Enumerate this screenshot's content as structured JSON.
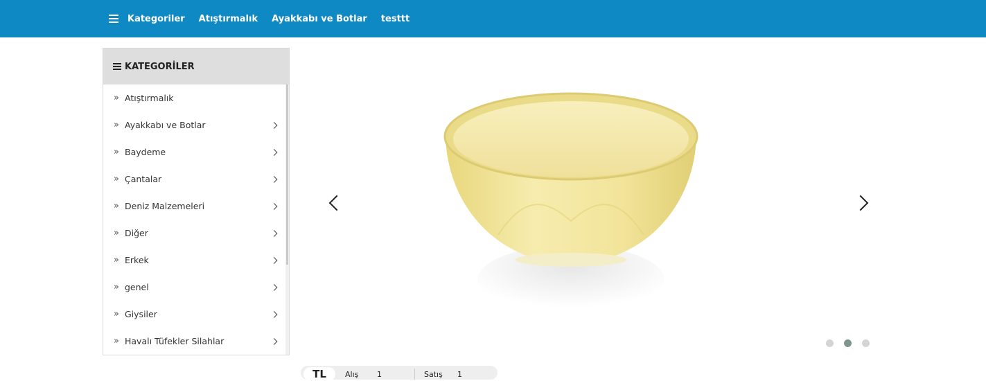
{
  "topnav": {
    "menu_icon": "hamburger-icon",
    "links": [
      "Kategoriler",
      "Atıştırmalık",
      "Ayakkabı ve Botlar",
      "testtt"
    ]
  },
  "categories": {
    "title": "KATEGORİLER",
    "items": [
      {
        "label": "Atıştırmalık",
        "has_sub": false
      },
      {
        "label": "Ayakkabı ve Botlar",
        "has_sub": true
      },
      {
        "label": "Baydeme",
        "has_sub": true
      },
      {
        "label": "Çantalar",
        "has_sub": true
      },
      {
        "label": "Deniz Malzemeleri",
        "has_sub": true
      },
      {
        "label": "Diğer",
        "has_sub": true
      },
      {
        "label": "Erkek",
        "has_sub": true
      },
      {
        "label": "genel",
        "has_sub": true
      },
      {
        "label": "Giysiler",
        "has_sub": true
      },
      {
        "label": "Havalı Tüfekler Silahlar",
        "has_sub": true
      }
    ]
  },
  "slider": {
    "prev_icon": "chevron-left-icon",
    "next_icon": "chevron-right-icon",
    "image": "yellow-bowl",
    "dot_count": 3,
    "active_dot": 1
  },
  "bottom_bar": {
    "currency": "TL",
    "buy_label": "Alış",
    "buy_value": "1",
    "sell_label": "Satış",
    "sell_value": "1"
  },
  "colors": {
    "topbar": "#0e89c4",
    "bowl": "#f1e49a",
    "active_dot": "#7f9590"
  }
}
